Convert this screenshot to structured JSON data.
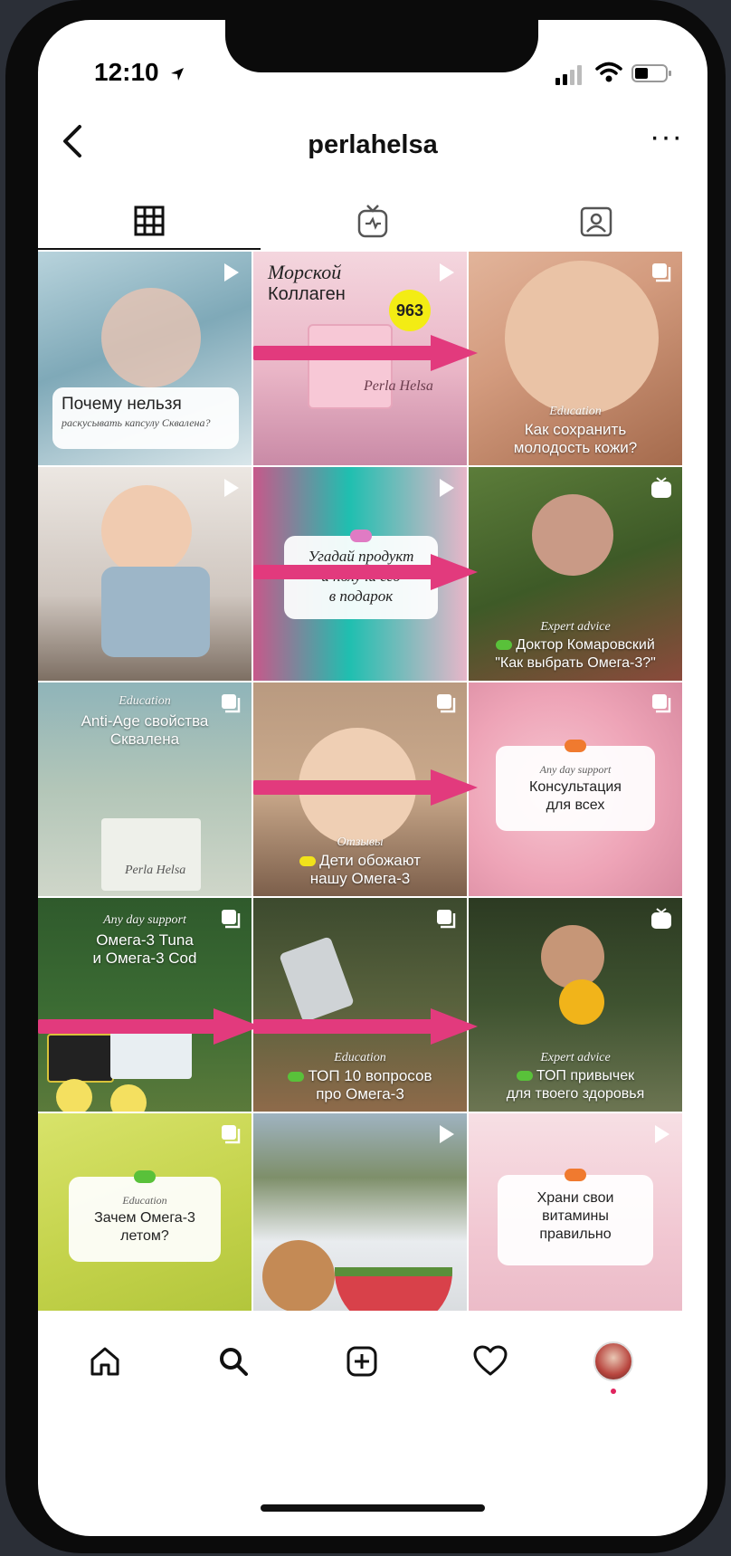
{
  "status_bar": {
    "time": "12:10"
  },
  "header": {
    "back_label": "<",
    "username": "perlahelsa",
    "more_label": "···"
  },
  "tabs": [
    {
      "name": "grid",
      "icon": "grid-icon",
      "selected": true
    },
    {
      "name": "igtv",
      "icon": "igtv-icon",
      "selected": false
    },
    {
      "name": "tagged",
      "icon": "tagged-person-icon",
      "selected": false
    }
  ],
  "posts": [
    {
      "badge": "reel-icon",
      "lines": [
        "Почему нельзя"
      ],
      "sub": "раскусывать капсулу Сквалена?"
    },
    {
      "badge": "reel-icon",
      "title_italic": "Морской",
      "title": "Коллаген",
      "price": "963",
      "brand": "Perla Helsa"
    },
    {
      "badge": "carousel-icon",
      "category": "Education",
      "lines": [
        "Как сохранить",
        "молодость кожи?"
      ]
    },
    {
      "badge": "reel-icon"
    },
    {
      "badge": "reel-icon",
      "card_lines": [
        "Угадай продукт",
        "и получи его",
        "в подарок"
      ]
    },
    {
      "badge": "igtv-icon",
      "category": "Expert advice",
      "lines": [
        "Доктор Комаровский",
        "\"Как выбрать Омега-3?\""
      ]
    },
    {
      "badge": "carousel-icon",
      "category": "Education",
      "lines": [
        "Anti-Age свойства",
        "Сквалена"
      ],
      "brand": "Perla Helsa"
    },
    {
      "badge": "carousel-icon",
      "category": "Отзывы",
      "lines": [
        "Дети обожают",
        "нашу Омега-3"
      ]
    },
    {
      "badge": "carousel-icon",
      "category": "Any day support",
      "card_lines": [
        "Консультация",
        "для всех"
      ]
    },
    {
      "badge": "carousel-icon",
      "category": "Any day support",
      "lines": [
        "Омега-3 Tuna",
        "и Омега-3 Cod"
      ]
    },
    {
      "badge": "carousel-icon",
      "category": "Education",
      "lines": [
        "ТОП 10 вопросов",
        "про Омега-3"
      ]
    },
    {
      "badge": "igtv-icon",
      "category": "Expert advice",
      "lines": [
        "ТОП привычек",
        "для твоего здоровья"
      ]
    },
    {
      "badge": "carousel-icon",
      "category": "Education",
      "card_lines": [
        "Зачем Омега-3",
        "летом?"
      ]
    },
    {
      "badge": "reel-icon"
    },
    {
      "badge": "reel-icon",
      "card_lines": [
        "Храни свои",
        "витамины",
        "правильно"
      ]
    }
  ],
  "bottom_nav": [
    "home-icon",
    "search-icon",
    "create-post-icon",
    "activity-heart-icon",
    "profile-avatar"
  ],
  "colors": {
    "arrow": "#e23a7d",
    "green_dot": "#59c13a",
    "orange_dot": "#f07a2f",
    "yellow_dot": "#f1e21a"
  }
}
